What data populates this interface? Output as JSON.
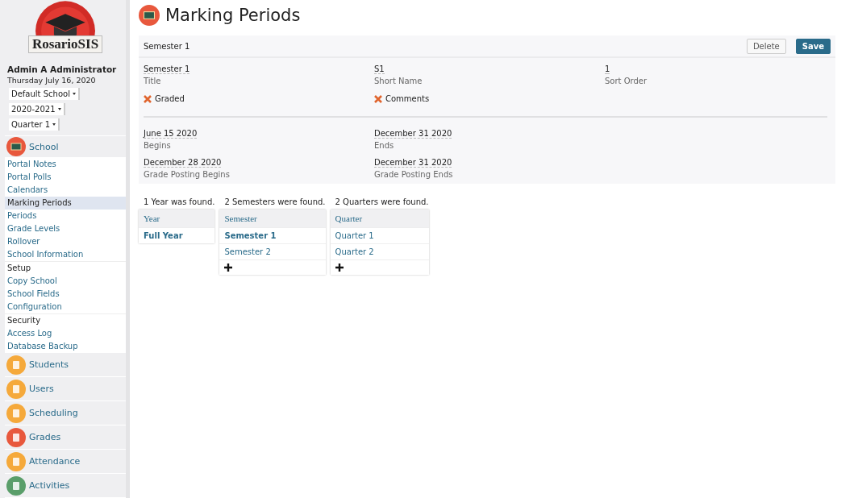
{
  "logo": {
    "text": "RosarioSIS"
  },
  "user": {
    "name": "Admin A Administrator",
    "date": "Thursday July 16, 2020"
  },
  "selects": [
    {
      "value": "Default School"
    },
    {
      "value": "2020-2021"
    },
    {
      "value": "Quarter 1"
    }
  ],
  "current_module": {
    "label": "School"
  },
  "menu": [
    {
      "label": "Portal Notes",
      "kind": "link",
      "selected": false
    },
    {
      "label": "Portal Polls",
      "kind": "link",
      "selected": false
    },
    {
      "label": "Calendars",
      "kind": "link",
      "selected": false
    },
    {
      "label": "Marking Periods",
      "kind": "link",
      "selected": true
    },
    {
      "label": "Periods",
      "kind": "link",
      "selected": false
    },
    {
      "label": "Grade Levels",
      "kind": "link",
      "selected": false
    },
    {
      "label": "Rollover",
      "kind": "link",
      "selected": false
    },
    {
      "label": "School Information",
      "kind": "link",
      "selected": false
    },
    {
      "label": "Setup",
      "kind": "header"
    },
    {
      "label": "Copy School",
      "kind": "link",
      "selected": false
    },
    {
      "label": "School Fields",
      "kind": "link",
      "selected": false
    },
    {
      "label": "Configuration",
      "kind": "link",
      "selected": false
    },
    {
      "label": "Security",
      "kind": "header"
    },
    {
      "label": "Access Log",
      "kind": "link",
      "selected": false
    },
    {
      "label": "Database Backup",
      "kind": "link",
      "selected": false
    }
  ],
  "modules": [
    {
      "label": "Students",
      "color": "#f5a93b"
    },
    {
      "label": "Users",
      "color": "#f5a93b"
    },
    {
      "label": "Scheduling",
      "color": "#f5a93b"
    },
    {
      "label": "Grades",
      "color": "#e8583d"
    },
    {
      "label": "Attendance",
      "color": "#f5a93b"
    },
    {
      "label": "Activities",
      "color": "#5a9e6a"
    }
  ],
  "page": {
    "title": "Marking Periods"
  },
  "form": {
    "header": "Semester 1",
    "buttons": [
      {
        "label": "Delete",
        "kind": "secondary"
      },
      {
        "label": "Save",
        "kind": "primary"
      }
    ],
    "fields": [
      {
        "value": "Semester 1",
        "label": "Title"
      },
      {
        "value": "S1",
        "label": "Short Name"
      },
      {
        "value": "1",
        "label": "Sort Order"
      }
    ],
    "checks": [
      {
        "label": "Graded",
        "checked": false
      },
      {
        "label": "Comments",
        "checked": false
      }
    ],
    "dates": [
      {
        "value": "June 15 2020",
        "label": "Begins"
      },
      {
        "value": "December 31 2020",
        "label": "Ends"
      },
      {
        "value": "December 28 2020",
        "label": "Grade Posting Begins"
      },
      {
        "value": "December 31 2020",
        "label": "Grade Posting Ends"
      }
    ]
  },
  "lists": [
    {
      "count": "1 Year was found.",
      "column": "Year",
      "rows": [
        {
          "label": "Full Year",
          "selected": true
        }
      ],
      "add": false
    },
    {
      "count": "2 Semesters were found.",
      "column": "Semester",
      "rows": [
        {
          "label": "Semester 1",
          "selected": true
        },
        {
          "label": "Semester 2",
          "selected": false
        }
      ],
      "add": true
    },
    {
      "count": "2 Quarters were found.",
      "column": "Quarter",
      "rows": [
        {
          "label": "Quarter 1",
          "selected": false
        },
        {
          "label": "Quarter 2",
          "selected": false
        }
      ],
      "add": true
    }
  ]
}
